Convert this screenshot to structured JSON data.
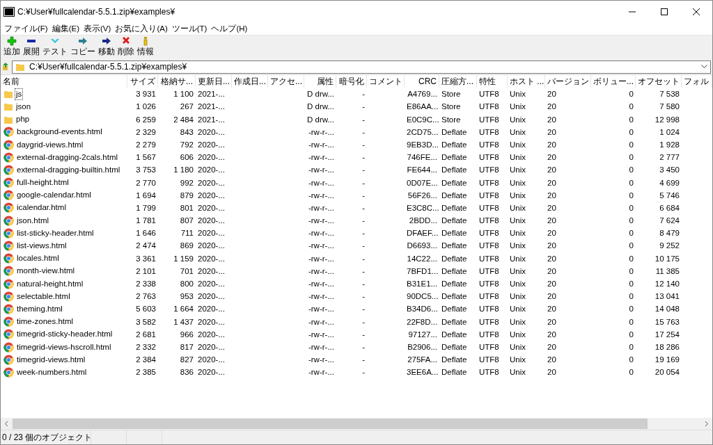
{
  "window": {
    "title": "C:¥User¥fullcalendar-5.5.1.zip¥examples¥"
  },
  "menu": [
    "ファイル(F)",
    "編集(E)",
    "表示(V)",
    "お気に入り(A)",
    "ツール(T)",
    "ヘルプ(H)"
  ],
  "toolbar": [
    {
      "kind": "add",
      "label": "追加"
    },
    {
      "kind": "extract",
      "label": "展開"
    },
    {
      "kind": "test",
      "label": "テスト"
    },
    {
      "kind": "copy",
      "label": "コピー"
    },
    {
      "kind": "move",
      "label": "移動"
    },
    {
      "kind": "delete",
      "label": "削除"
    },
    {
      "kind": "info",
      "label": "情報"
    }
  ],
  "address": {
    "value": "C:¥User¥fullcalendar-5.5.1.zip¥examples¥"
  },
  "table": {
    "columns": [
      "名前",
      "サイズ",
      "格納サ...",
      "更新日...",
      "作成日...",
      "アクセ...",
      "属性",
      "暗号化",
      "コメント",
      "CRC",
      "圧縮方...",
      "特性",
      "ホスト ...",
      "バージョン",
      "ボリュー...",
      "オフセット",
      "フォル"
    ],
    "rows": [
      {
        "kind": "folder",
        "focused": true,
        "cells": [
          "js",
          "3 931",
          "1 100",
          "2021-...",
          "",
          "",
          "D drw...",
          "-",
          "",
          "A4769...",
          "Store",
          "UTF8",
          "Unix",
          "20",
          "0",
          "7 538"
        ]
      },
      {
        "kind": "folder",
        "focused": false,
        "cells": [
          "json",
          "1 026",
          "267",
          "2021-...",
          "",
          "",
          "D drw...",
          "-",
          "",
          "E86AA...",
          "Store",
          "UTF8",
          "Unix",
          "20",
          "0",
          "7 580"
        ]
      },
      {
        "kind": "folder",
        "focused": false,
        "cells": [
          "php",
          "6 259",
          "2 484",
          "2021-...",
          "",
          "",
          "D drw...",
          "-",
          "",
          "E0C9C...",
          "Store",
          "UTF8",
          "Unix",
          "20",
          "0",
          "12 998"
        ]
      },
      {
        "kind": "html",
        "focused": false,
        "cells": [
          "background-events.html",
          "2 329",
          "843",
          "2020-...",
          "",
          "",
          "-rw-r-...",
          "-",
          "",
          "2CD75...",
          "Deflate",
          "UTF8",
          "Unix",
          "20",
          "0",
          "1 024"
        ]
      },
      {
        "kind": "html",
        "focused": false,
        "cells": [
          "daygrid-views.html",
          "2 279",
          "792",
          "2020-...",
          "",
          "",
          "-rw-r-...",
          "-",
          "",
          "9EB3D...",
          "Deflate",
          "UTF8",
          "Unix",
          "20",
          "0",
          "1 928"
        ]
      },
      {
        "kind": "html",
        "focused": false,
        "cells": [
          "external-dragging-2cals.html",
          "1 567",
          "606",
          "2020-...",
          "",
          "",
          "-rw-r-...",
          "-",
          "",
          "746FE...",
          "Deflate",
          "UTF8",
          "Unix",
          "20",
          "0",
          "2 777"
        ]
      },
      {
        "kind": "html",
        "focused": false,
        "cells": [
          "external-dragging-builtin.html",
          "3 753",
          "1 180",
          "2020-...",
          "",
          "",
          "-rw-r-...",
          "-",
          "",
          "FE644...",
          "Deflate",
          "UTF8",
          "Unix",
          "20",
          "0",
          "3 450"
        ]
      },
      {
        "kind": "html",
        "focused": false,
        "cells": [
          "full-height.html",
          "2 770",
          "992",
          "2020-...",
          "",
          "",
          "-rw-r-...",
          "-",
          "",
          "0D07E...",
          "Deflate",
          "UTF8",
          "Unix",
          "20",
          "0",
          "4 699"
        ]
      },
      {
        "kind": "html",
        "focused": false,
        "cells": [
          "google-calendar.html",
          "1 694",
          "879",
          "2020-...",
          "",
          "",
          "-rw-r-...",
          "-",
          "",
          "56F26...",
          "Deflate",
          "UTF8",
          "Unix",
          "20",
          "0",
          "5 746"
        ]
      },
      {
        "kind": "html",
        "focused": false,
        "cells": [
          "icalendar.html",
          "1 799",
          "801",
          "2020-...",
          "",
          "",
          "-rw-r-...",
          "-",
          "",
          "E3C8C...",
          "Deflate",
          "UTF8",
          "Unix",
          "20",
          "0",
          "6 684"
        ]
      },
      {
        "kind": "html",
        "focused": false,
        "cells": [
          "json.html",
          "1 781",
          "807",
          "2020-...",
          "",
          "",
          "-rw-r-...",
          "-",
          "",
          "2BDD...",
          "Deflate",
          "UTF8",
          "Unix",
          "20",
          "0",
          "7 624"
        ]
      },
      {
        "kind": "html",
        "focused": false,
        "cells": [
          "list-sticky-header.html",
          "1 646",
          "711",
          "2020-...",
          "",
          "",
          "-rw-r-...",
          "-",
          "",
          "DFAEF...",
          "Deflate",
          "UTF8",
          "Unix",
          "20",
          "0",
          "8 479"
        ]
      },
      {
        "kind": "html",
        "focused": false,
        "cells": [
          "list-views.html",
          "2 474",
          "869",
          "2020-...",
          "",
          "",
          "-rw-r-...",
          "-",
          "",
          "D6693...",
          "Deflate",
          "UTF8",
          "Unix",
          "20",
          "0",
          "9 252"
        ]
      },
      {
        "kind": "html",
        "focused": false,
        "cells": [
          "locales.html",
          "3 361",
          "1 159",
          "2020-...",
          "",
          "",
          "-rw-r-...",
          "-",
          "",
          "14C22...",
          "Deflate",
          "UTF8",
          "Unix",
          "20",
          "0",
          "10 175"
        ]
      },
      {
        "kind": "html",
        "focused": false,
        "cells": [
          "month-view.html",
          "2 101",
          "701",
          "2020-...",
          "",
          "",
          "-rw-r-...",
          "-",
          "",
          "7BFD1...",
          "Deflate",
          "UTF8",
          "Unix",
          "20",
          "0",
          "11 385"
        ]
      },
      {
        "kind": "html",
        "focused": false,
        "cells": [
          "natural-height.html",
          "2 338",
          "800",
          "2020-...",
          "",
          "",
          "-rw-r-...",
          "-",
          "",
          "B31E1...",
          "Deflate",
          "UTF8",
          "Unix",
          "20",
          "0",
          "12 140"
        ]
      },
      {
        "kind": "html",
        "focused": false,
        "cells": [
          "selectable.html",
          "2 763",
          "953",
          "2020-...",
          "",
          "",
          "-rw-r-...",
          "-",
          "",
          "90DC5...",
          "Deflate",
          "UTF8",
          "Unix",
          "20",
          "0",
          "13 041"
        ]
      },
      {
        "kind": "html",
        "focused": false,
        "cells": [
          "theming.html",
          "5 603",
          "1 664",
          "2020-...",
          "",
          "",
          "-rw-r-...",
          "-",
          "",
          "B34D6...",
          "Deflate",
          "UTF8",
          "Unix",
          "20",
          "0",
          "14 048"
        ]
      },
      {
        "kind": "html",
        "focused": false,
        "cells": [
          "time-zones.html",
          "3 582",
          "1 437",
          "2020-...",
          "",
          "",
          "-rw-r-...",
          "-",
          "",
          "22F8D...",
          "Deflate",
          "UTF8",
          "Unix",
          "20",
          "0",
          "15 763"
        ]
      },
      {
        "kind": "html",
        "focused": false,
        "cells": [
          "timegrid-sticky-header.html",
          "2 681",
          "966",
          "2020-...",
          "",
          "",
          "-rw-r-...",
          "-",
          "",
          "97127...",
          "Deflate",
          "UTF8",
          "Unix",
          "20",
          "0",
          "17 254"
        ]
      },
      {
        "kind": "html",
        "focused": false,
        "cells": [
          "timegrid-views-hscroll.html",
          "2 332",
          "817",
          "2020-...",
          "",
          "",
          "-rw-r-...",
          "-",
          "",
          "B2906...",
          "Deflate",
          "UTF8",
          "Unix",
          "20",
          "0",
          "18 286"
        ]
      },
      {
        "kind": "html",
        "focused": false,
        "cells": [
          "timegrid-views.html",
          "2 384",
          "827",
          "2020-...",
          "",
          "",
          "-rw-r-...",
          "-",
          "",
          "275FA...",
          "Deflate",
          "UTF8",
          "Unix",
          "20",
          "0",
          "19 169"
        ]
      },
      {
        "kind": "html",
        "focused": false,
        "cells": [
          "week-numbers.html",
          "2 385",
          "836",
          "2020-...",
          "",
          "",
          "-rw-r-...",
          "-",
          "",
          "3EE6A...",
          "Deflate",
          "UTF8",
          "Unix",
          "20",
          "0",
          "20 054"
        ]
      }
    ]
  },
  "status_bar": "0 / 23 個のオブジェクト"
}
